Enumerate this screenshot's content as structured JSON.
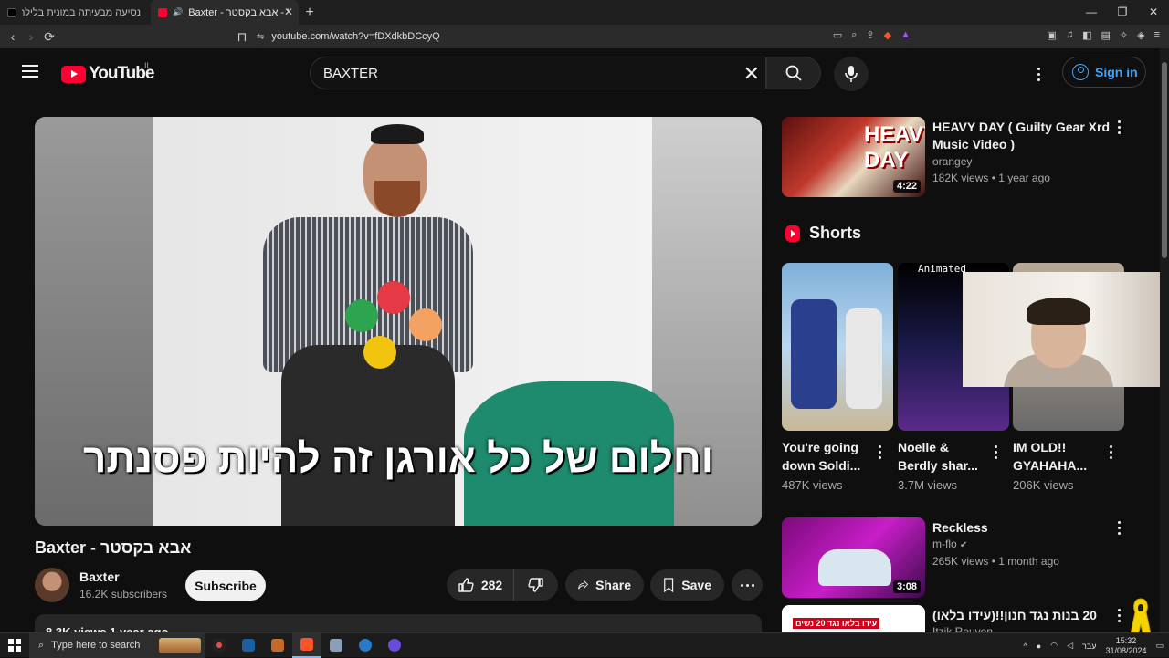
{
  "browser": {
    "tabs": [
      {
        "label": "נסיעה מבעיתה במונית בלילה עם נהג"
      },
      {
        "label": "Baxter - אבא בקסטר - YouTube",
        "active": true
      }
    ],
    "url": "youtube.com/watch?v=fDXdkbDCcyQ"
  },
  "header": {
    "logo_text": "YouTube",
    "country_code": "IL",
    "search_value": "BAXTER",
    "signin_label": "Sign in"
  },
  "video": {
    "subtitle": "וחלום של כל אורגן זה להיות פסנתר",
    "title": "Baxter - אבא בקסטר",
    "channel": "Baxter",
    "subscribers": "16.2K subscribers",
    "subscribe_label": "Subscribe",
    "likes": "282",
    "share_label": "Share",
    "save_label": "Save",
    "desc_preview": "8.3K views  1 year ago"
  },
  "sidebar": {
    "rec1": {
      "title": "HEAVY DAY ( Guilty Gear Xrd Music Video )",
      "channel": "orangey",
      "meta": "182K views • 1 year ago",
      "duration": "4:22"
    },
    "shorts_label": "Shorts",
    "shorts": [
      {
        "title": "You're going down Soldi...",
        "views": "487K views"
      },
      {
        "title": "Noelle & Berdly shar...",
        "views": "3.7M views"
      },
      {
        "title": "IM OLD!! GYAHAHA...",
        "views": "206K views"
      }
    ],
    "rec2": {
      "title": "Reckless",
      "channel": "m-flo",
      "meta": "265K views • 1 month ago",
      "duration": "3:08"
    },
    "rec3": {
      "title": "20 בנות נגד חנון!!(עידו בלאו)",
      "channel": "Itzik Reuven"
    }
  },
  "taskbar": {
    "search_placeholder": "Type here to search",
    "lang": "עבר",
    "time": "15:32",
    "date": "31/08/2024"
  },
  "colors": {
    "accent": "#ff0033",
    "link": "#3ea6ff",
    "bg": "#0f0f0f"
  }
}
